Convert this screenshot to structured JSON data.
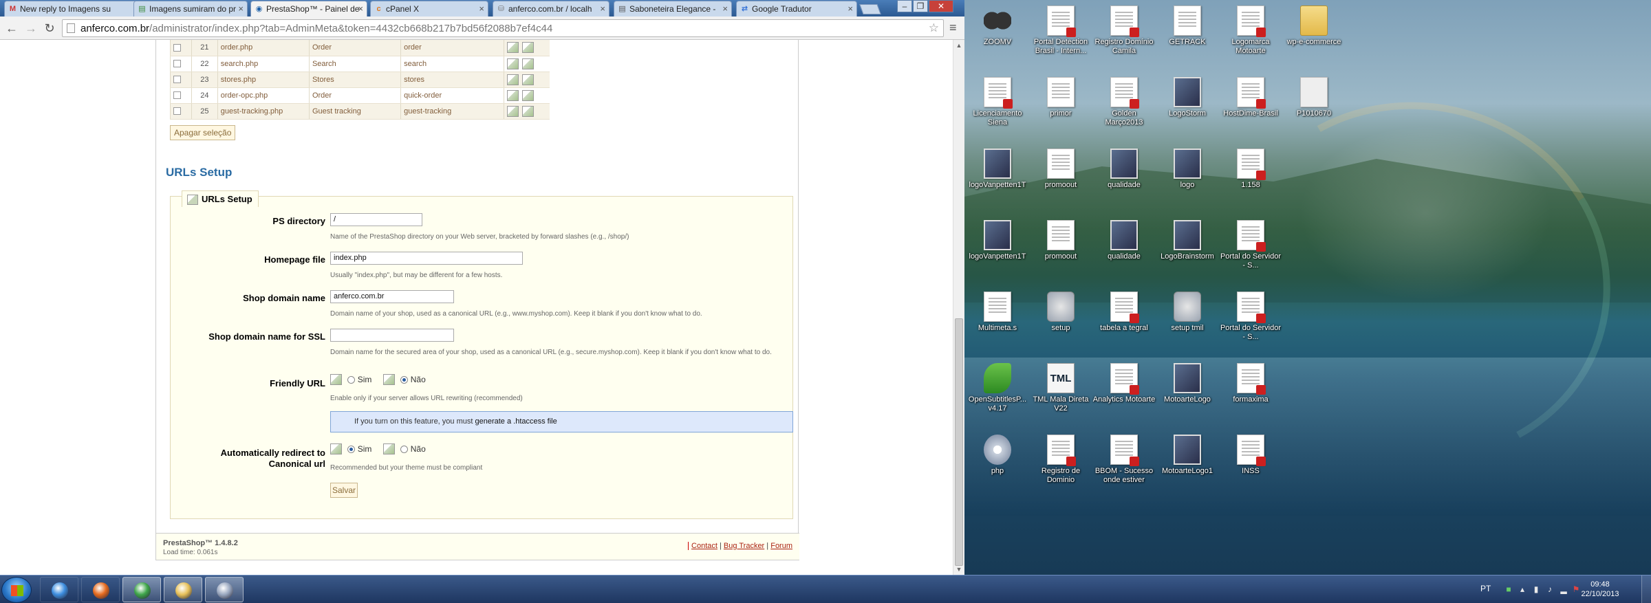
{
  "browser": {
    "tabs": [
      {
        "label": "New reply to Imagens su",
        "icon": "gmail-icon",
        "active": false
      },
      {
        "label": "Imagens sumiram do pr",
        "icon": "page-icon",
        "active": false
      },
      {
        "label": "PrestaShop™ - Painel de",
        "icon": "prestashop-icon",
        "active": true
      },
      {
        "label": "cPanel X",
        "icon": "cpanel-icon",
        "active": false
      },
      {
        "label": "anferco.com.br / localh",
        "icon": "phpmyadmin-icon",
        "active": false
      },
      {
        "label": "Saboneteira Elegance -",
        "icon": "page-icon",
        "active": false
      },
      {
        "label": "Google Tradutor",
        "icon": "google-translate-icon",
        "active": false
      }
    ],
    "url_host": "anferco.com.br",
    "url_path": "/administrator/index.php?tab=AdminMeta&token=4432cb668b217b7bd56f2088b7ef4c44",
    "window_minimize": "–",
    "window_restore": "❐",
    "window_close": "✕"
  },
  "pages_table": {
    "rows": [
      {
        "id": "21",
        "page": "order.php",
        "title": "Order",
        "url": "order"
      },
      {
        "id": "22",
        "page": "search.php",
        "title": "Search",
        "url": "search"
      },
      {
        "id": "23",
        "page": "stores.php",
        "title": "Stores",
        "url": "stores"
      },
      {
        "id": "24",
        "page": "order-opc.php",
        "title": "Order",
        "url": "quick-order"
      },
      {
        "id": "25",
        "page": "guest-tracking.php",
        "title": "Guest tracking",
        "url": "guest-tracking"
      }
    ],
    "delete_selection_label": "Apagar seleção"
  },
  "urls_setup": {
    "section_title": "URLs Setup",
    "legend": "URLs Setup",
    "ps_directory": {
      "label": "PS directory",
      "value": "/",
      "hint": "Name of the PrestaShop directory on your Web server, bracketed by forward slashes (e.g., /shop/)"
    },
    "homepage_file": {
      "label": "Homepage file",
      "value": "index.php",
      "hint": "Usually \"index.php\", but may be different for a few hosts."
    },
    "shop_domain": {
      "label": "Shop domain name",
      "value": "anferco.com.br",
      "hint": "Domain name of your shop, used as a canonical URL (e.g., www.myshop.com). Keep it blank if you don't know what to do."
    },
    "shop_domain_ssl": {
      "label": "Shop domain name for SSL",
      "value": "",
      "hint": "Domain name for the secured area of your shop, used as a canonical URL (e.g., secure.myshop.com). Keep it blank if you don't know what to do."
    },
    "friendly_url": {
      "label": "Friendly URL",
      "option_yes": "Sim",
      "option_no": "Não",
      "selected": "Não",
      "hint": "Enable only if your server allows URL rewriting (recommended)"
    },
    "info_box": {
      "text": "If you turn on this feature, you must",
      "link": "generate a .htaccess file"
    },
    "canonical_redirect": {
      "label_line1": "Automatically redirect to",
      "label_line2": "Canonical url",
      "option_yes": "Sim",
      "option_no": "Não",
      "selected": "Sim",
      "hint": "Recommended but your theme must be compliant"
    },
    "save_label": "Salvar"
  },
  "footer": {
    "version": "PrestaShop™ 1.4.8.2",
    "load_time": "Load time: 0.061s",
    "links": [
      "Contact",
      "Bug Tracker",
      "Forum"
    ],
    "separator": "|"
  },
  "desktop_icons": [
    {
      "label": "ZOOMV",
      "icon": "binoculars-icon"
    },
    {
      "label": "Portal Detection Brasil - Intern...",
      "icon": "pdf-icon"
    },
    {
      "label": "Registro Domínio Camila",
      "icon": "pdf-icon"
    },
    {
      "label": "GETRACK",
      "icon": "document-icon"
    },
    {
      "label": "Logomarca Motoarte",
      "icon": "pdf-icon"
    },
    {
      "label": "wp-e-commerce",
      "icon": "folder-icon"
    },
    {
      "label": "Licenciamento Siena",
      "icon": "pdf-icon"
    },
    {
      "label": "primor",
      "icon": "document-icon"
    },
    {
      "label": "Golden Março2013",
      "icon": "pdf-icon"
    },
    {
      "label": "LogoStorm",
      "icon": "image-icon"
    },
    {
      "label": "HostDime-Brasil",
      "icon": "pdf-icon"
    },
    {
      "label": "P1010670",
      "icon": "photo-icon"
    },
    {
      "label": "logoVanpetten1T",
      "icon": "image-icon"
    },
    {
      "label": "promoout",
      "icon": "document-icon"
    },
    {
      "label": "qualidade",
      "icon": "image-icon"
    },
    {
      "label": "logo",
      "icon": "image-icon"
    },
    {
      "label": "1.158",
      "icon": "pdf-icon"
    },
    {
      "label": "logoVanpetten1T",
      "icon": "image-icon"
    },
    {
      "label": "promoout",
      "icon": "document-icon"
    },
    {
      "label": "qualidade",
      "icon": "image-icon"
    },
    {
      "label": "LogoBrainstorm",
      "icon": "image-icon"
    },
    {
      "label": "Portal do Servidor - S...",
      "icon": "pdf-icon"
    },
    {
      "label": "Multimeta.s",
      "icon": "document-icon"
    },
    {
      "label": "setup",
      "icon": "cd-setup-icon"
    },
    {
      "label": "tabela a tegral",
      "icon": "pdf-icon"
    },
    {
      "label": "setup tmil",
      "icon": "setup-icon"
    },
    {
      "label": "Portal do Servidor - S...",
      "icon": "pdf-icon"
    },
    {
      "label": "OpenSubtitlesP... v4.17",
      "icon": "opensubtitles-icon"
    },
    {
      "label": "TML Mala Direta V22",
      "icon": "tml-icon"
    },
    {
      "label": "Analytics Motoarte",
      "icon": "pdf-icon"
    },
    {
      "label": "MotoarteLogo",
      "icon": "image-icon"
    },
    {
      "label": "formaxima",
      "icon": "pdf-icon"
    },
    {
      "label": "php",
      "icon": "gear-icon"
    },
    {
      "label": "Registro de Dominio",
      "icon": "pdf-icon"
    },
    {
      "label": "BBOM - Sucesso onde estiver",
      "icon": "pdf-icon"
    },
    {
      "label": "MotoarteLogo1",
      "icon": "image-icon"
    },
    {
      "label": "INSS",
      "icon": "pdf-icon"
    }
  ],
  "taskbar": {
    "apps": [
      {
        "name": "internet-explorer-icon",
        "state": "pinned",
        "color": "#3d8ee0"
      },
      {
        "name": "firefox-icon",
        "state": "pinned",
        "color": "#e66b1f"
      },
      {
        "name": "chrome-icon",
        "state": "running",
        "color": "#3fa64a"
      },
      {
        "name": "explorer-icon",
        "state": "running",
        "color": "#e7c15a"
      },
      {
        "name": "utility-icon",
        "state": "running",
        "color": "#9aa8c0"
      }
    ],
    "language": "PT",
    "time": "09:48",
    "date": "22/10/2013"
  },
  "colors": {
    "link_brown": "#815d3b",
    "title_blue": "#2a6ba3",
    "form_bg": "#fffff0",
    "info_bg": "#dde8fb",
    "taskbar_top": "#3b5a8a"
  }
}
